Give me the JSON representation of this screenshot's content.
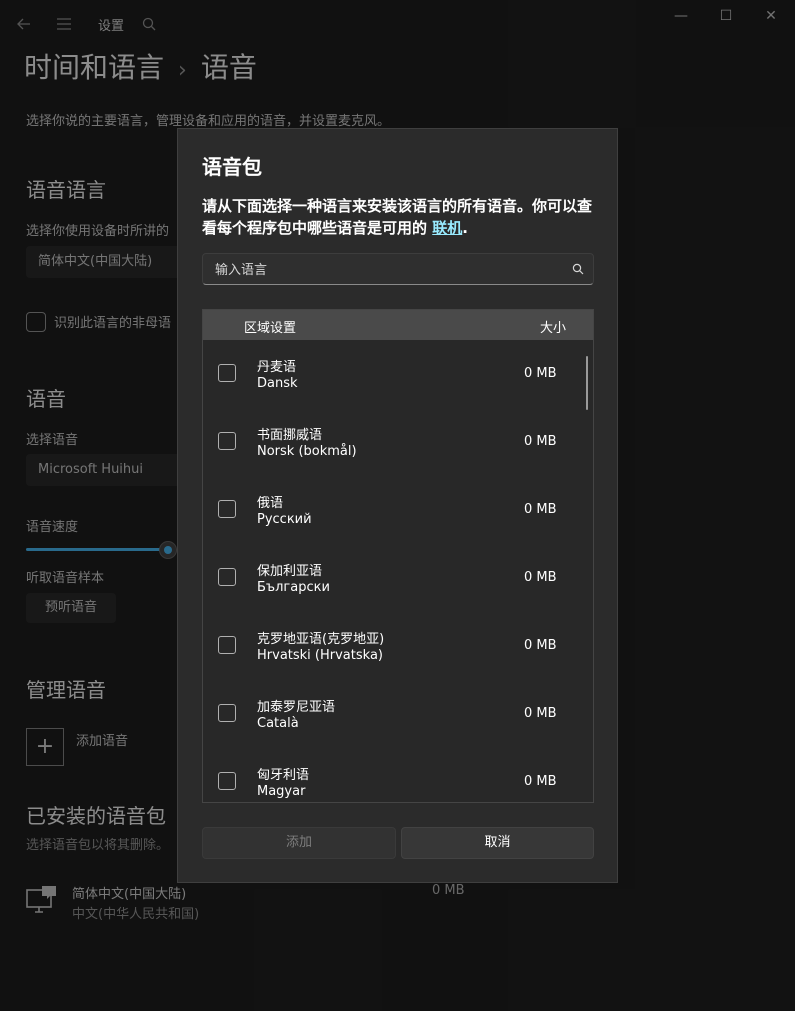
{
  "window": {
    "title": "设置",
    "minimize": "—",
    "maximize": "☐",
    "close": "✕"
  },
  "breadcrumb": {
    "parent": "时间和语言",
    "separator": "›",
    "current": "语音"
  },
  "page": {
    "description": "选择你说的主要语言，管理设备和应用的语音，并设置麦克风。",
    "speech_language_heading": "语音语言",
    "speech_language_label": "选择你使用设备时所讲的",
    "speech_language_value": "简体中文(中国大陆)",
    "non_native_checkbox_label": "识别此语言的非母语",
    "voice_heading": "语音",
    "choose_voice_label": "选择语音",
    "choose_voice_value": "Microsoft Huihui",
    "speed_label": "语音速度",
    "speed_fraction": 0.84,
    "sample_label": "听取语音样本",
    "preview_button": "预听语音",
    "manage_heading": "管理语音",
    "add_voice_label": "添加语音",
    "installed_heading": "已安装的语音包",
    "installed_desc": "选择语音包以将其删除。",
    "installed_item": {
      "name": "简体中文(中国大陆)",
      "sub": "中文(中华人民共和国)",
      "size": "0 MB"
    }
  },
  "dialog": {
    "title": "语音包",
    "desc_text": "请从下面选择一种语言来安装该语言的所有语音。你可以查看每个程序包中哪些语音是可用的 ",
    "desc_link": "联机",
    "desc_end": ".",
    "search_placeholder": "输入语言",
    "col_region": "区域设置",
    "col_size": "大小",
    "rows": [
      {
        "name": "丹麦语",
        "native": "Dansk",
        "size": "0 MB"
      },
      {
        "name": "书面挪威语",
        "native": "Norsk (bokmål)",
        "size": "0 MB"
      },
      {
        "name": "俄语",
        "native": "Русский",
        "size": "0 MB"
      },
      {
        "name": "保加利亚语",
        "native": "Български",
        "size": "0 MB"
      },
      {
        "name": "克罗地亚语(克罗地亚)",
        "native": "Hrvatski (Hrvatska)",
        "size": "0 MB"
      },
      {
        "name": "加泰罗尼亚语",
        "native": "Català",
        "size": "0 MB"
      },
      {
        "name": "匈牙利语",
        "native": "Magyar",
        "size": "0 MB"
      }
    ],
    "add_button": "添加",
    "cancel_button": "取消"
  }
}
